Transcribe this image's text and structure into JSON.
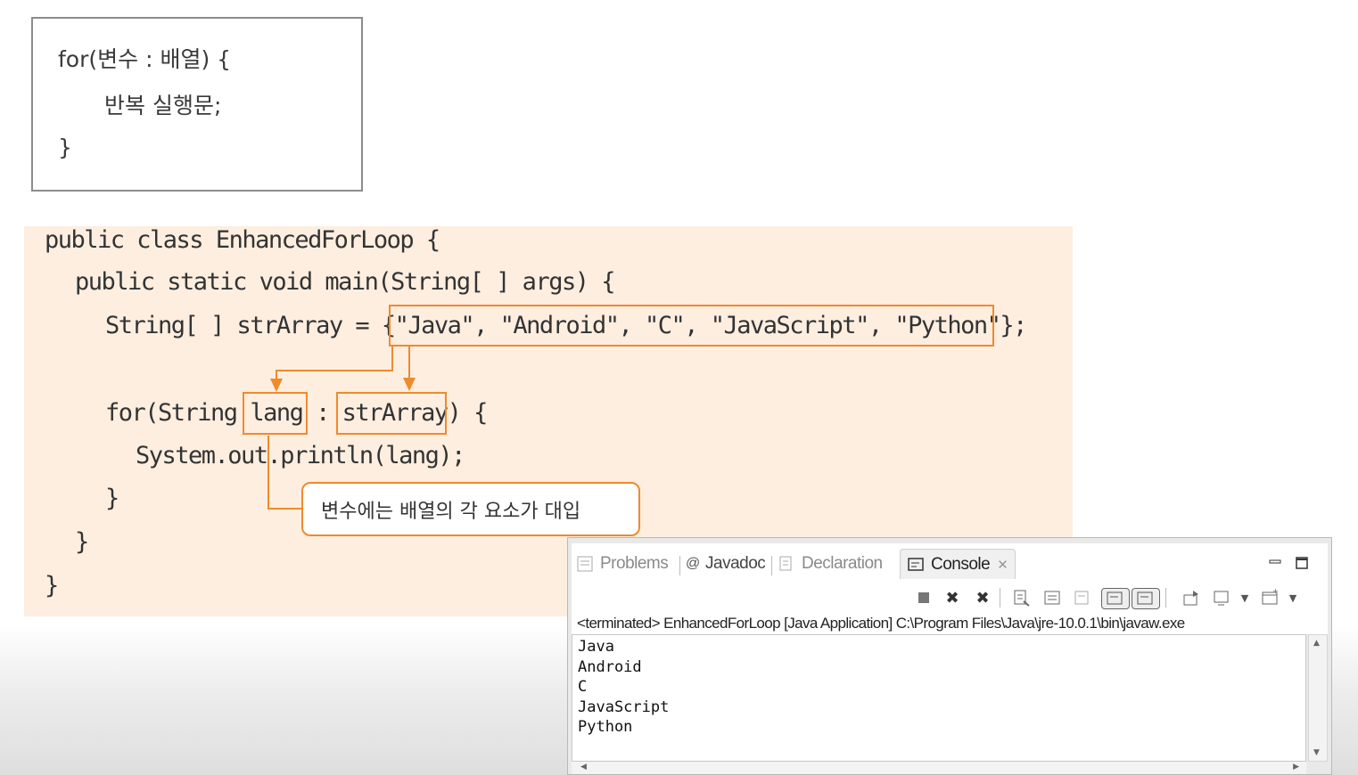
{
  "syntax": {
    "line1": "for(변수 : 배열) {",
    "line2": "반복 실행문;",
    "line3": "}"
  },
  "code": {
    "line1": "public class EnhancedForLoop {",
    "line2": "public static void main(String[ ] args) {",
    "line3_prefix": "String[ ] strArray = {",
    "line3_values": "\"Java\", \"Android\", \"C\", \"JavaScript\", \"Python\"",
    "line3_suffix": "};",
    "line4_prefix": "for(String ",
    "line4_var": "lang",
    "line4_colon": " : ",
    "line4_array": "strArray",
    "line4_suffix": ") {",
    "line5": "System.out.println(lang);",
    "line6": "}",
    "line7": "}",
    "line8": "}"
  },
  "callout": {
    "text": "변수에는 배열의 각 요소가 대입"
  },
  "accent_color": "#f08a2c",
  "console": {
    "tabs": [
      {
        "label": "Problems",
        "icon": "problems-icon"
      },
      {
        "label": "Javadoc",
        "icon": "javadoc-icon"
      },
      {
        "label": "Declaration",
        "icon": "declaration-icon"
      },
      {
        "label": "Console",
        "icon": "console-icon"
      }
    ],
    "status": "<terminated> EnhancedForLoop [Java Application] C:\\Program Files\\Java\\jre-10.0.1\\bin\\javaw.exe",
    "output": [
      "Java",
      "Android",
      "C",
      "JavaScript",
      "Python"
    ]
  }
}
